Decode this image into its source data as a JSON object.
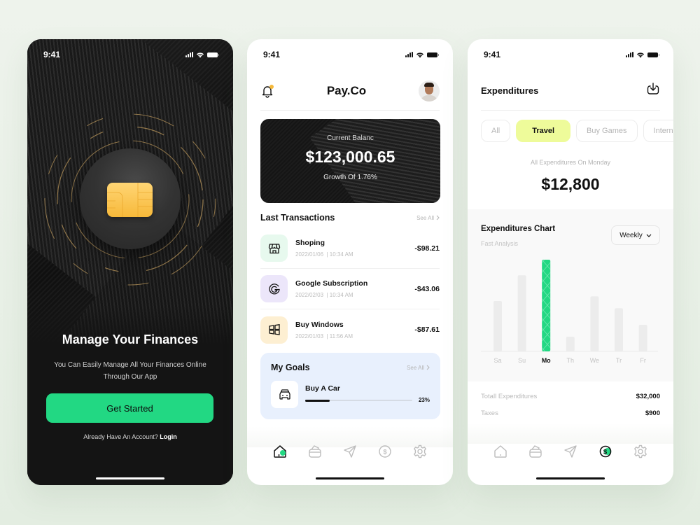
{
  "status_bar": {
    "time": "9:41"
  },
  "onboarding": {
    "title": "Manage Your Finances",
    "subtitle_line1": "You Can Easily Manage All Your Finances Online",
    "subtitle_line2": "Through Our App",
    "cta_label": "Get Started",
    "login_prompt": "Already Have An Account?",
    "login_label": "Login",
    "accent_color": "#22d883"
  },
  "home": {
    "brand": "Pay.Co",
    "balance": {
      "label": "Current Balanc",
      "amount": "$123,000.65",
      "growth": "Growth Of 1.76%"
    },
    "transactions": {
      "title": "Last Transactions",
      "see_all": "See All",
      "items": [
        {
          "name": "Shoping",
          "date": "2022/01/06",
          "time": "10:34 AM",
          "amount": "-$98.21",
          "icon": "store-icon",
          "tint": "#e7f9ee"
        },
        {
          "name": "Google Subscription",
          "date": "2022/02/03",
          "time": "10:34 AM",
          "amount": "-$43.06",
          "icon": "google-icon",
          "tint": "#ece6fa"
        },
        {
          "name": "Buy Windows",
          "date": "2022/01/03",
          "time": "11:56 AM",
          "amount": "-$87.61",
          "icon": "windows-icon",
          "tint": "#fdefd2"
        }
      ]
    },
    "goals": {
      "title": "My Goals",
      "see_all": "See All",
      "items": [
        {
          "name": "Buy A Car",
          "progress_percent": 23,
          "progress_label": "23%",
          "icon": "car-icon"
        }
      ]
    },
    "tabbar": {
      "items": [
        "home",
        "wallet",
        "send",
        "dollar",
        "settings"
      ],
      "active": "home"
    }
  },
  "expenditures": {
    "title": "Expenditures",
    "filters": [
      "All",
      "Travel",
      "Buy Games",
      "Intern"
    ],
    "active_filter": "Travel",
    "subtitle": "All Expenditures On Monday",
    "amount": "$12,800",
    "chart_title": "Expenditures Chart",
    "chart_subtitle": "Fast Analysis",
    "period": "Weekly",
    "totals": [
      {
        "label": "Totall Expenditures",
        "value": "$32,000"
      },
      {
        "label": "Taxes",
        "value": "$900"
      }
    ],
    "tabbar": {
      "items": [
        "home",
        "wallet",
        "send",
        "dollar",
        "settings"
      ],
      "active": "dollar"
    }
  },
  "chart_data": {
    "type": "bar",
    "title": "Expenditures Chart",
    "subtitle": "Fast Analysis",
    "categories": [
      "Sa",
      "Su",
      "Mo",
      "Th",
      "We",
      "Tr",
      "Fr"
    ],
    "values": [
      55,
      83,
      100,
      16,
      60,
      47,
      29
    ],
    "highlighted": "Mo",
    "ylim": [
      0,
      100
    ],
    "xlabel": "",
    "ylabel": "",
    "grid": false,
    "colors": {
      "bar": "#ececec",
      "highlight": "#22d883"
    }
  }
}
